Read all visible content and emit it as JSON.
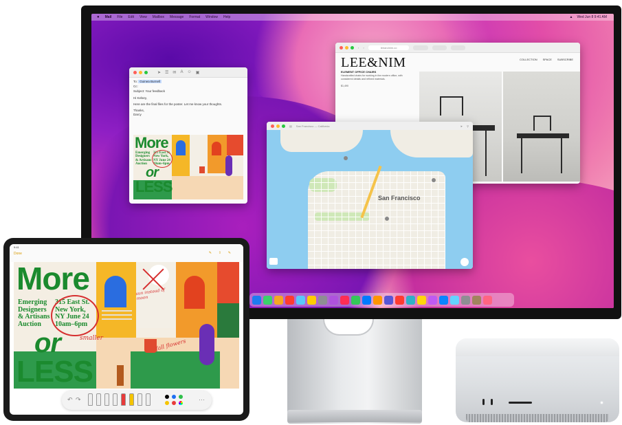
{
  "mac": {
    "menubar": {
      "apple_icon": "apple-icon",
      "items": [
        "Mail",
        "File",
        "Edit",
        "View",
        "Mailbox",
        "Message",
        "Format",
        "Window",
        "Help"
      ],
      "status": [
        "Wed Jun 8 9:41 AM"
      ]
    },
    "mail": {
      "to": "Guinea Burnell",
      "cc": "",
      "subject": "Subject: Your feedback",
      "greeting": "Hi Kelsey,",
      "body": "Here are the final files for the poster. Let me know your thoughts.",
      "signoff": "Thanks,",
      "signature": "Darcy"
    },
    "browser": {
      "url": "leeandnim.co",
      "logo": "LEE&NIM",
      "nav": [
        "COLLECTION",
        "SPACE",
        "SUBSCRIBE"
      ],
      "heading": "ELEMENT OFFICE CHAIRS",
      "description": "Handcrafted chairs for working in the modern office, with considered details and refined materials.",
      "price": "$1,490"
    },
    "maps": {
      "title": "San Francisco — California",
      "city_label": "San Francisco"
    },
    "dock": {
      "colors": [
        "#1e7bf0",
        "#3ad16b",
        "#f5a623",
        "#ff3b30",
        "#5ac8fa",
        "#ffcc00",
        "#8e8e93",
        "#af52de",
        "#ff2d55",
        "#34c759",
        "#007aff",
        "#ff9500",
        "#5856d6",
        "#ff3b30",
        "#30b0c7",
        "#ffd60a",
        "#bf5af2",
        "#0a84ff",
        "#64d2ff",
        "#8e8e93",
        "#a2845e",
        "#ff6482"
      ]
    }
  },
  "poster": {
    "headline_1": "More",
    "headline_2": "or",
    "headline_3": "LESS",
    "subtitle": "Emerging Designers & Artisans Auction",
    "address": "315 East St. New York, NY June 24 10am–6pm",
    "annotation_smaller": "smaller",
    "annotation_fall": "fall flowers",
    "annotation_sun": "sun instead of moon"
  },
  "ipad": {
    "done_label": "Done",
    "status_time": "9:41"
  },
  "palette_colors": [
    "#000000",
    "#1e6ff2",
    "#2fbf4a",
    "#f5c400",
    "#e83b3b"
  ],
  "icons": [
    "search-icon",
    "pen-icon",
    "share-icon",
    "compose-icon",
    "location-icon"
  ]
}
